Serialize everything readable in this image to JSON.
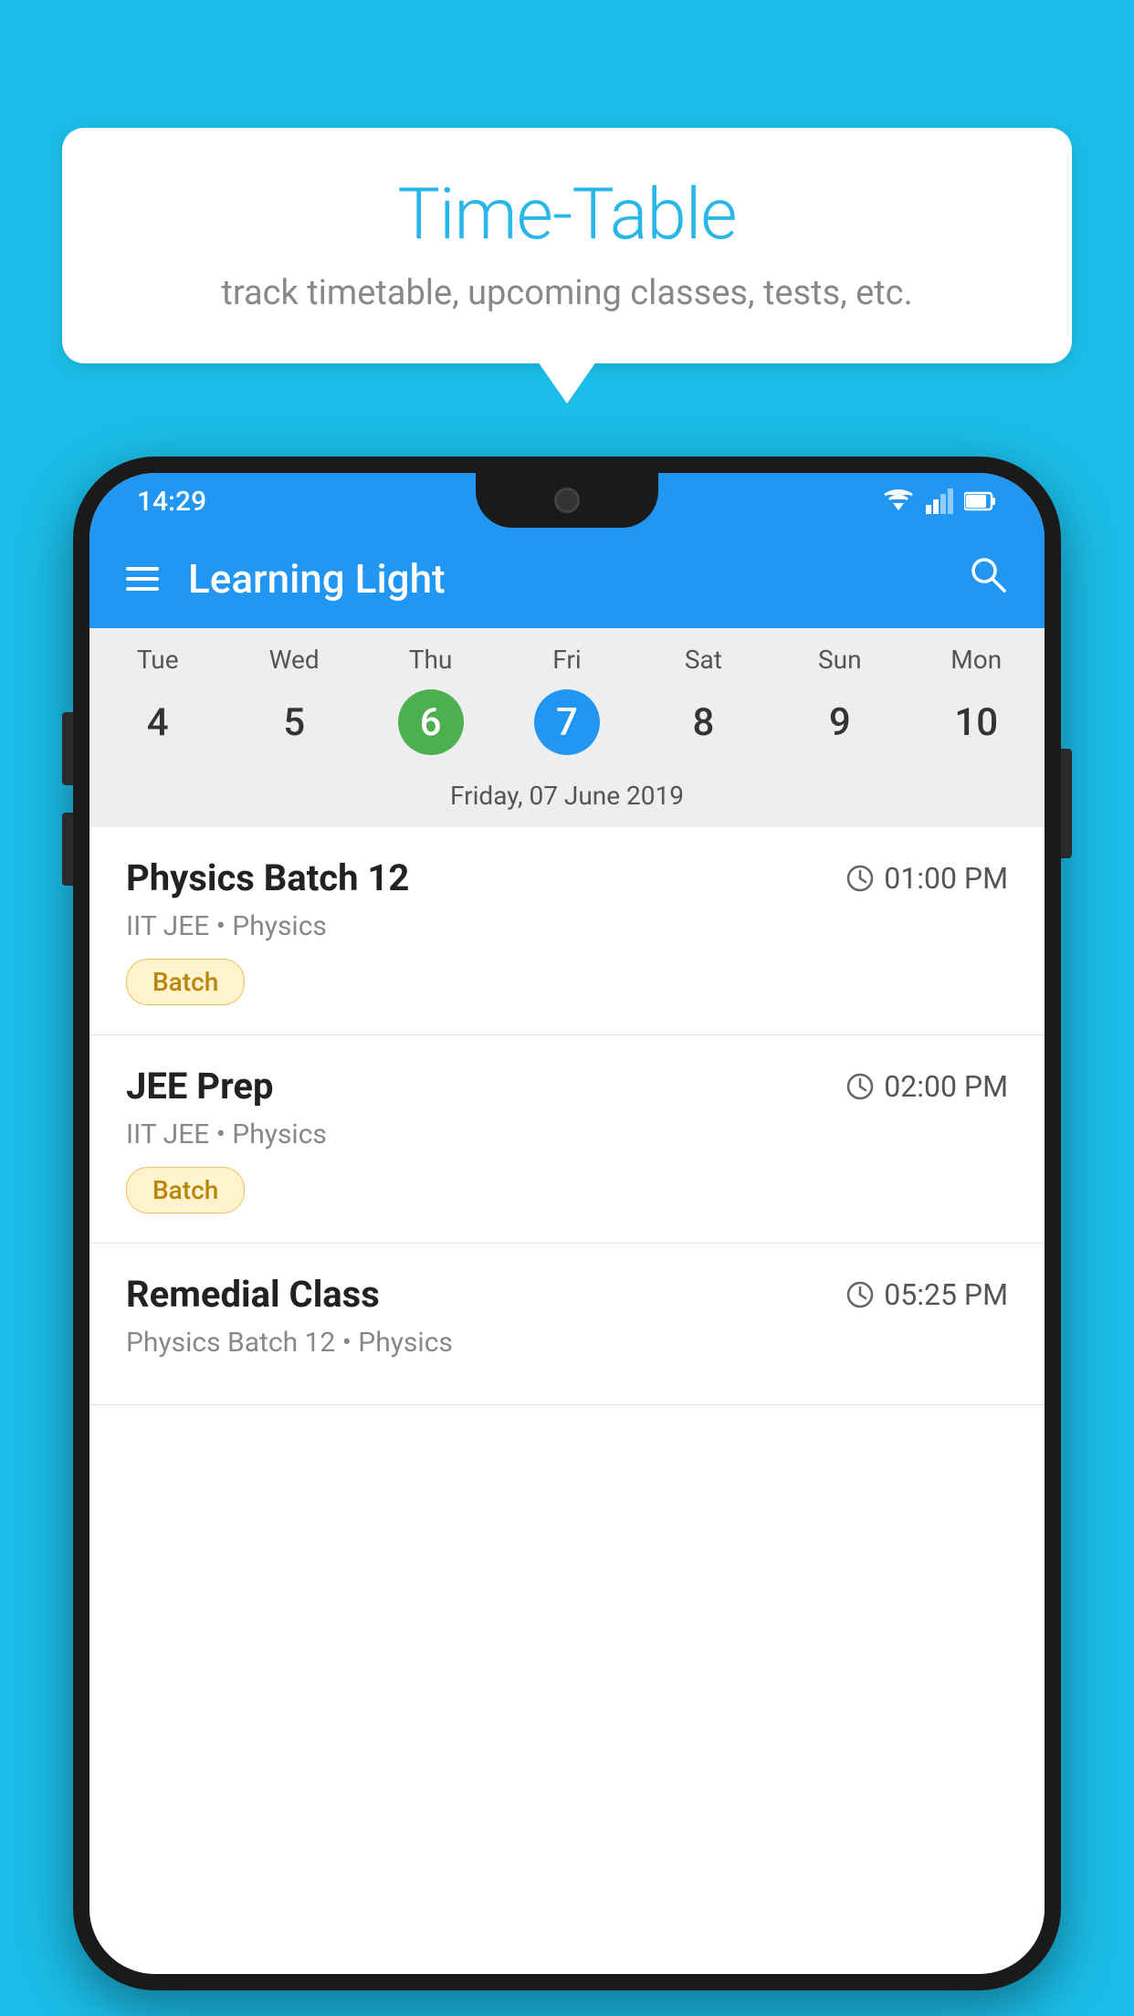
{
  "background_color": "#1BBDE8",
  "bubble": {
    "title": "Time-Table",
    "subtitle": "track timetable, upcoming classes, tests, etc."
  },
  "status_bar": {
    "time": "14:29"
  },
  "app_bar": {
    "title": "Learning Light"
  },
  "calendar": {
    "days": [
      {
        "name": "Tue",
        "num": "4"
      },
      {
        "name": "Wed",
        "num": "5"
      },
      {
        "name": "Thu",
        "num": "6",
        "state": "today"
      },
      {
        "name": "Fri",
        "num": "7",
        "state": "selected"
      },
      {
        "name": "Sat",
        "num": "8"
      },
      {
        "name": "Sun",
        "num": "9"
      },
      {
        "name": "Mon",
        "num": "10"
      }
    ],
    "selected_date_label": "Friday, 07 June 2019"
  },
  "events": [
    {
      "name": "Physics Batch 12",
      "time": "01:00 PM",
      "meta": "IIT JEE • Physics",
      "tag": "Batch"
    },
    {
      "name": "JEE Prep",
      "time": "02:00 PM",
      "meta": "IIT JEE • Physics",
      "tag": "Batch"
    },
    {
      "name": "Remedial Class",
      "time": "05:25 PM",
      "meta": "Physics Batch 12 • Physics",
      "tag": ""
    }
  ]
}
